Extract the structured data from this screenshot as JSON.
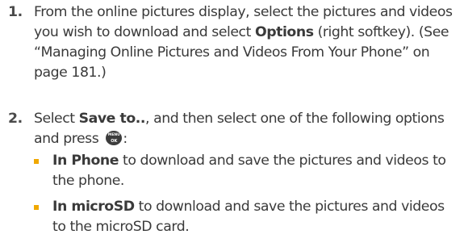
{
  "steps": [
    {
      "number": "1.",
      "text_before": "From the online pictures display, select the pictures and videos you wish to download and select ",
      "bold_term": "Options",
      "text_after": " (right softkey). (See “Managing Online Pictures and Videos From Your Phone” on page 181.)"
    },
    {
      "number": "2.",
      "text_before": "Select ",
      "bold_term": "Save to..",
      "text_middle": ", and then select one of the following options and press ",
      "key_icon": {
        "name": "menu-ok-key-icon",
        "line1": "MENU",
        "line2": "OK"
      },
      "text_after": ":",
      "options": [
        {
          "bold_term": "In Phone",
          "text": " to download and save the pictures and videos to the phone."
        },
        {
          "bold_term": "In microSD",
          "text": " to download and save the pictures and videos to the microSD card."
        }
      ]
    }
  ],
  "colors": {
    "text": "#3a3a3a",
    "bullet": "#f0a800",
    "key_icon_bg": "#3c3c3c"
  }
}
